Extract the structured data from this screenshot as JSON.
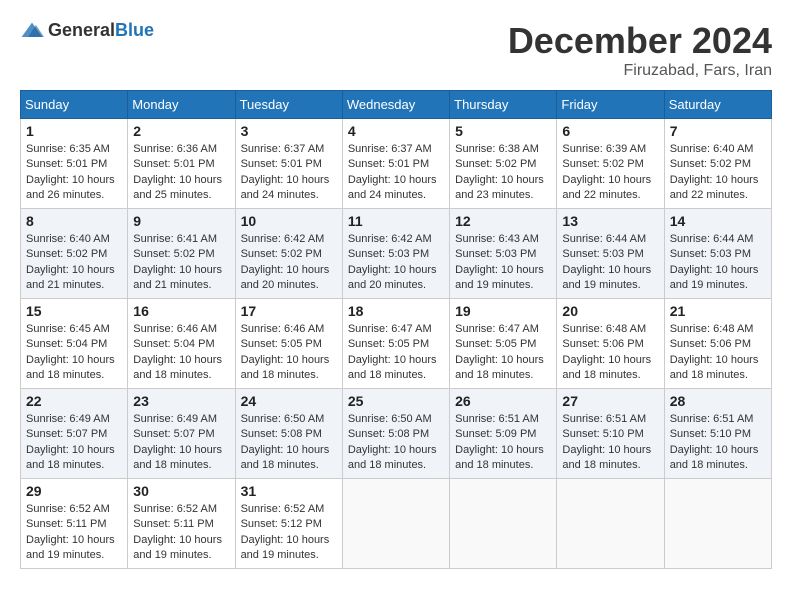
{
  "logo": {
    "general": "General",
    "blue": "Blue"
  },
  "header": {
    "month_title": "December 2024",
    "location": "Firuzabad, Fars, Iran"
  },
  "weekdays": [
    "Sunday",
    "Monday",
    "Tuesday",
    "Wednesday",
    "Thursday",
    "Friday",
    "Saturday"
  ],
  "weeks": [
    [
      {
        "day": "1",
        "sunrise": "6:35 AM",
        "sunset": "5:01 PM",
        "daylight": "10 hours and 26 minutes."
      },
      {
        "day": "2",
        "sunrise": "6:36 AM",
        "sunset": "5:01 PM",
        "daylight": "10 hours and 25 minutes."
      },
      {
        "day": "3",
        "sunrise": "6:37 AM",
        "sunset": "5:01 PM",
        "daylight": "10 hours and 24 minutes."
      },
      {
        "day": "4",
        "sunrise": "6:37 AM",
        "sunset": "5:01 PM",
        "daylight": "10 hours and 24 minutes."
      },
      {
        "day": "5",
        "sunrise": "6:38 AM",
        "sunset": "5:02 PM",
        "daylight": "10 hours and 23 minutes."
      },
      {
        "day": "6",
        "sunrise": "6:39 AM",
        "sunset": "5:02 PM",
        "daylight": "10 hours and 22 minutes."
      },
      {
        "day": "7",
        "sunrise": "6:40 AM",
        "sunset": "5:02 PM",
        "daylight": "10 hours and 22 minutes."
      }
    ],
    [
      {
        "day": "8",
        "sunrise": "6:40 AM",
        "sunset": "5:02 PM",
        "daylight": "10 hours and 21 minutes."
      },
      {
        "day": "9",
        "sunrise": "6:41 AM",
        "sunset": "5:02 PM",
        "daylight": "10 hours and 21 minutes."
      },
      {
        "day": "10",
        "sunrise": "6:42 AM",
        "sunset": "5:02 PM",
        "daylight": "10 hours and 20 minutes."
      },
      {
        "day": "11",
        "sunrise": "6:42 AM",
        "sunset": "5:03 PM",
        "daylight": "10 hours and 20 minutes."
      },
      {
        "day": "12",
        "sunrise": "6:43 AM",
        "sunset": "5:03 PM",
        "daylight": "10 hours and 19 minutes."
      },
      {
        "day": "13",
        "sunrise": "6:44 AM",
        "sunset": "5:03 PM",
        "daylight": "10 hours and 19 minutes."
      },
      {
        "day": "14",
        "sunrise": "6:44 AM",
        "sunset": "5:03 PM",
        "daylight": "10 hours and 19 minutes."
      }
    ],
    [
      {
        "day": "15",
        "sunrise": "6:45 AM",
        "sunset": "5:04 PM",
        "daylight": "10 hours and 18 minutes."
      },
      {
        "day": "16",
        "sunrise": "6:46 AM",
        "sunset": "5:04 PM",
        "daylight": "10 hours and 18 minutes."
      },
      {
        "day": "17",
        "sunrise": "6:46 AM",
        "sunset": "5:05 PM",
        "daylight": "10 hours and 18 minutes."
      },
      {
        "day": "18",
        "sunrise": "6:47 AM",
        "sunset": "5:05 PM",
        "daylight": "10 hours and 18 minutes."
      },
      {
        "day": "19",
        "sunrise": "6:47 AM",
        "sunset": "5:05 PM",
        "daylight": "10 hours and 18 minutes."
      },
      {
        "day": "20",
        "sunrise": "6:48 AM",
        "sunset": "5:06 PM",
        "daylight": "10 hours and 18 minutes."
      },
      {
        "day": "21",
        "sunrise": "6:48 AM",
        "sunset": "5:06 PM",
        "daylight": "10 hours and 18 minutes."
      }
    ],
    [
      {
        "day": "22",
        "sunrise": "6:49 AM",
        "sunset": "5:07 PM",
        "daylight": "10 hours and 18 minutes."
      },
      {
        "day": "23",
        "sunrise": "6:49 AM",
        "sunset": "5:07 PM",
        "daylight": "10 hours and 18 minutes."
      },
      {
        "day": "24",
        "sunrise": "6:50 AM",
        "sunset": "5:08 PM",
        "daylight": "10 hours and 18 minutes."
      },
      {
        "day": "25",
        "sunrise": "6:50 AM",
        "sunset": "5:08 PM",
        "daylight": "10 hours and 18 minutes."
      },
      {
        "day": "26",
        "sunrise": "6:51 AM",
        "sunset": "5:09 PM",
        "daylight": "10 hours and 18 minutes."
      },
      {
        "day": "27",
        "sunrise": "6:51 AM",
        "sunset": "5:10 PM",
        "daylight": "10 hours and 18 minutes."
      },
      {
        "day": "28",
        "sunrise": "6:51 AM",
        "sunset": "5:10 PM",
        "daylight": "10 hours and 18 minutes."
      }
    ],
    [
      {
        "day": "29",
        "sunrise": "6:52 AM",
        "sunset": "5:11 PM",
        "daylight": "10 hours and 19 minutes."
      },
      {
        "day": "30",
        "sunrise": "6:52 AM",
        "sunset": "5:11 PM",
        "daylight": "10 hours and 19 minutes."
      },
      {
        "day": "31",
        "sunrise": "6:52 AM",
        "sunset": "5:12 PM",
        "daylight": "10 hours and 19 minutes."
      },
      null,
      null,
      null,
      null
    ]
  ]
}
